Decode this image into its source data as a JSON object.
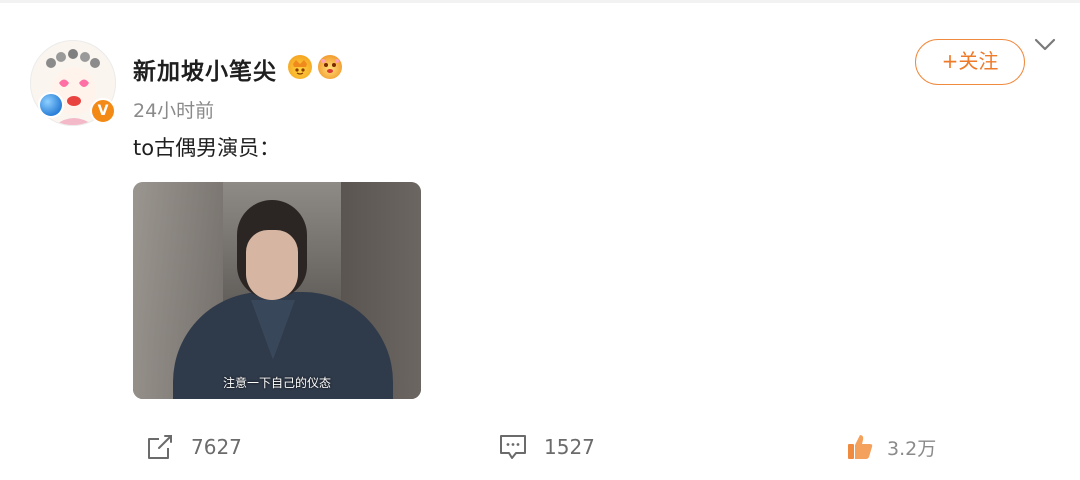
{
  "post": {
    "username": "新加坡小笔尖",
    "time": "24小时前",
    "text": "to古偶男演员：",
    "follow_label": "+关注",
    "verified_badge": "V",
    "image_subtitle": "注意一下自己的仪态"
  },
  "actions": {
    "repost_count": "7627",
    "comment_count": "1527",
    "like_count": "3.2万"
  },
  "colors": {
    "accent": "#ed7b2a",
    "badge": "#f48a16"
  },
  "icons": [
    "avatar",
    "globe-icon",
    "verified-badge",
    "crown-emoji-icon",
    "emoji-icon",
    "chevron-down-icon",
    "repost-icon",
    "comment-icon",
    "like-icon"
  ]
}
